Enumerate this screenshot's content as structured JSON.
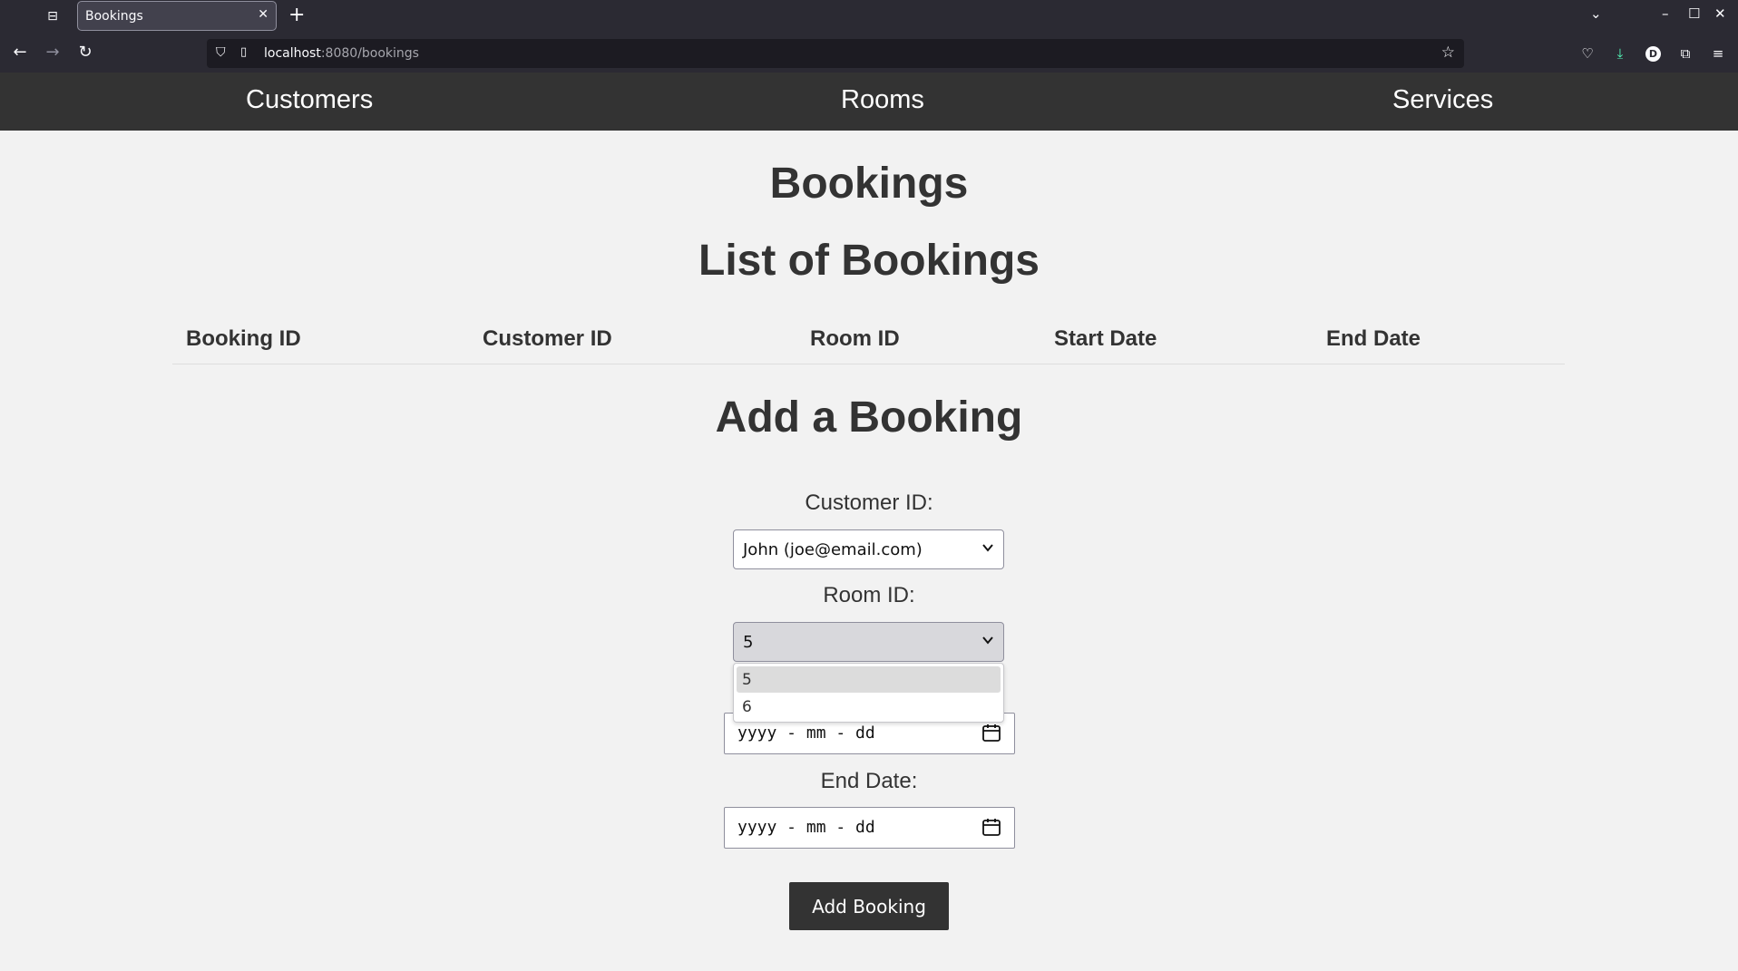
{
  "browser": {
    "tab_title": "Bookings",
    "tab_close": "✕",
    "new_tab": "+",
    "url_host": "localhost",
    "url_rest": ":8080/bookings",
    "profile_initial": "D",
    "icons": [
      "tab-list-icon",
      "back-icon",
      "forward-icon",
      "reload-icon",
      "shield-icon",
      "page-icon",
      "bookmark-star-icon",
      "pocket-icon",
      "download-icon",
      "profile-icon",
      "extensions-icon",
      "menu-icon",
      "minimize-icon",
      "maximize-icon",
      "close-window-icon",
      "list-all-tabs-icon"
    ]
  },
  "site_nav": {
    "customers": "Customers",
    "rooms": "Rooms",
    "services": "Services"
  },
  "page": {
    "title": "Bookings",
    "list_heading": "List of Bookings",
    "table_headers": [
      "Booking ID",
      "Customer ID",
      "Room ID",
      "Start Date",
      "End Date"
    ],
    "table_rows": [],
    "form_heading": "Add a Booking",
    "customer_label": "Customer ID:",
    "customer_selected": "John (joe@email.com)",
    "room_label": "Room ID:",
    "room_selected": "5",
    "room_options": [
      "5",
      "6"
    ],
    "start_placeholder": "yyyy - mm - dd",
    "end_label": "End Date:",
    "end_placeholder": "yyyy - mm - dd",
    "submit_label": "Add Booking"
  },
  "colors": {
    "nav_bg": "#333333",
    "page_bg": "#f2f2f2",
    "button_bg": "#333333",
    "browser_chrome": "#2b2a33"
  }
}
